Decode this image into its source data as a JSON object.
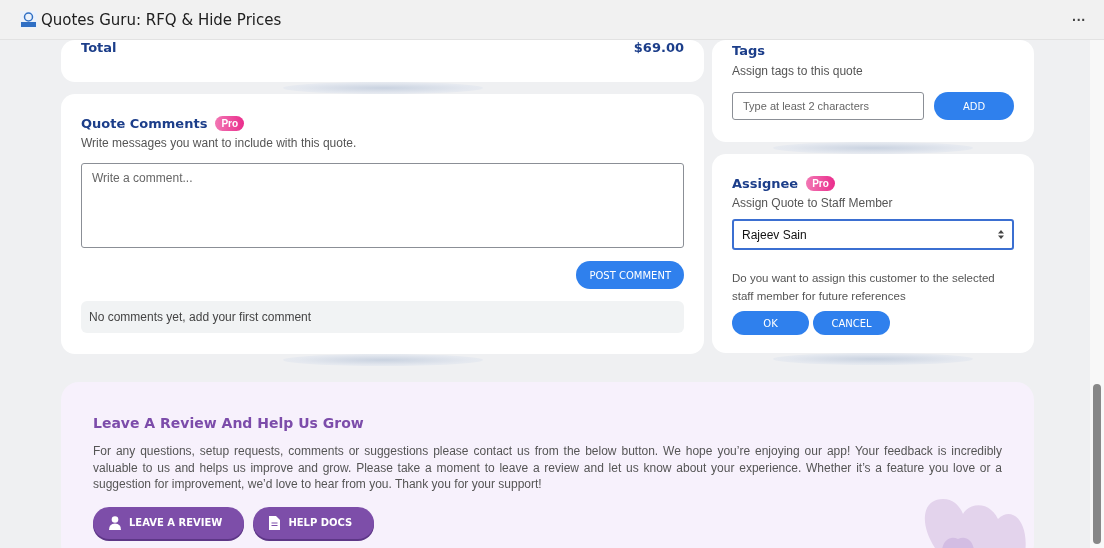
{
  "window": {
    "title": "Quotes Guru: RFQ & Hide Prices",
    "menu": "···"
  },
  "summary": {
    "label": "Total",
    "value": "$69.00"
  },
  "comments": {
    "title": "Quote Comments",
    "badge": "Pro",
    "subtitle": "Write messages you want to include with this quote.",
    "placeholder": "Write a comment...",
    "button": "POST COMMENT",
    "empty": "No comments yet, add your first comment"
  },
  "tags": {
    "title": "Tags",
    "subtitle": "Assign tags to this quote",
    "placeholder": "Type at least 2 characters",
    "button": "ADD"
  },
  "assignee": {
    "title": "Assignee",
    "badge": "Pro",
    "subtitle": "Assign Quote to Staff Member",
    "value": "Rajeev Sain",
    "question": "Do you want to assign this customer to the selected staff member for future references",
    "buttons": [
      "OK",
      "CANCEL"
    ]
  },
  "review": {
    "title": "Leave A Review And Help Us Grow",
    "text": "For any questions, setup requests, comments or suggestions please contact us from the below button. We hope you’re enjoying our app! Your feedback is incredibly valuable to us and helps us improve and grow. Please take a moment to leave a review and let us know about your experience. Whether it’s a feature you love or a suggestion for improvement, we’d love to hear from you. Thank you for your support!",
    "buttons": [
      {
        "label": "LEAVE A REVIEW",
        "kind": "user"
      },
      {
        "label": "HELP DOCS",
        "kind": "doc"
      }
    ]
  }
}
